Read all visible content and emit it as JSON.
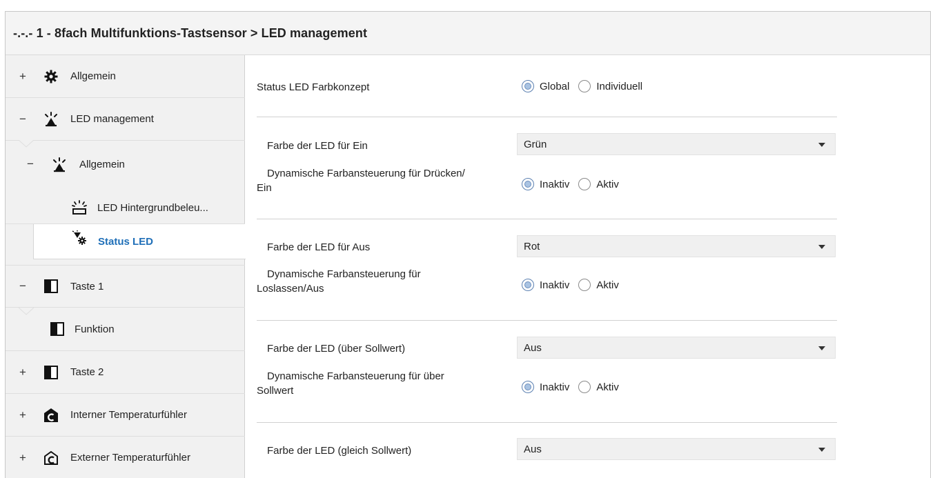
{
  "header": {
    "title": "-.-.- 1 - 8fach Multifunktions-Tastsensor > LED management"
  },
  "sidebar": {
    "items": [
      {
        "toggle": "+",
        "icon": "gear-icon",
        "label": "Allgemein"
      },
      {
        "toggle": "−",
        "icon": "led-lamp-icon",
        "label": "LED management"
      },
      {
        "toggle": "−",
        "icon": "led-lamp-icon",
        "label": "Allgemein"
      },
      {
        "toggle": "",
        "icon": "led-backlight-icon",
        "label": "LED Hintergrundbeleu..."
      },
      {
        "toggle": "",
        "icon": "status-led-icon",
        "label": "Status LED"
      },
      {
        "toggle": "−",
        "icon": "button-half-icon",
        "label": "Taste 1"
      },
      {
        "toggle": "",
        "icon": "button-half-icon",
        "label": "Funktion"
      },
      {
        "toggle": "+",
        "icon": "button-half-icon",
        "label": "Taste 2"
      },
      {
        "toggle": "+",
        "icon": "house-c-icon",
        "label": "Interner Temperaturfühler"
      },
      {
        "toggle": "+",
        "icon": "house-c-outline-icon",
        "label": "Externer Temperaturfühler"
      }
    ]
  },
  "main": {
    "farbkonzept": {
      "label": "Status LED Farbkonzept",
      "options": [
        "Global",
        "Individuell"
      ],
      "selected": "Global"
    },
    "sections": [
      {
        "color_label": "Farbe der LED für Ein",
        "color_value": "Grün",
        "dyn_label_line1": "Dynamische Farbansteuerung für Drücken/",
        "dyn_label_line2": "Ein",
        "options": [
          "Inaktiv",
          "Aktiv"
        ],
        "selected": "Inaktiv"
      },
      {
        "color_label": "Farbe der LED für Aus",
        "color_value": "Rot",
        "dyn_label_line1": "Dynamische Farbansteuerung für",
        "dyn_label_line2": "Loslassen/Aus",
        "options": [
          "Inaktiv",
          "Aktiv"
        ],
        "selected": "Inaktiv"
      },
      {
        "color_label": "Farbe der LED (über Sollwert)",
        "color_value": "Aus",
        "dyn_label_line1": "Dynamische Farbansteuerung für über",
        "dyn_label_line2": "Sollwert",
        "options": [
          "Inaktiv",
          "Aktiv"
        ],
        "selected": "Inaktiv"
      },
      {
        "color_label": "Farbe der LED (gleich Sollwert)",
        "color_value": "Aus"
      }
    ]
  }
}
